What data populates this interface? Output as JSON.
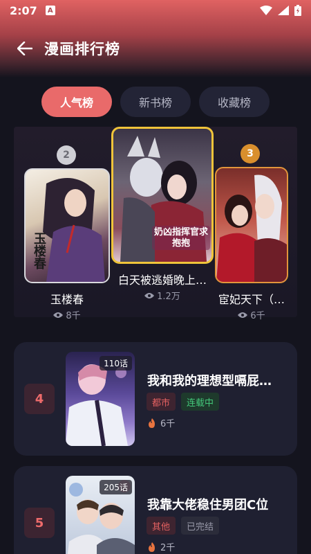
{
  "status": {
    "time": "2:07",
    "notif_letter": "A"
  },
  "app_bar": {
    "title": "漫画排行榜"
  },
  "tabs": [
    {
      "label": "人气榜",
      "active": true
    },
    {
      "label": "新书榜",
      "active": false
    },
    {
      "label": "收藏榜",
      "active": false
    }
  ],
  "podium": {
    "first": {
      "title": "白天被逃婚晚上…",
      "views": "1.2万",
      "cover_text": "奶凶指挥官求抱抱"
    },
    "second": {
      "rank": "2",
      "title": "玉楼春",
      "views": "8千",
      "cover_text": "玉楼春"
    },
    "third": {
      "rank": "3",
      "title": "宦妃天下（…",
      "views": "6千"
    }
  },
  "list": [
    {
      "rank": "4",
      "title": "我和我的理想型嗝屁…",
      "episodes": "110话",
      "tags": [
        "都市",
        "连载中"
      ],
      "hot": "6千"
    },
    {
      "rank": "5",
      "title": "我靠大佬稳住男团C位",
      "episodes": "205话",
      "tags": [
        "其他",
        "已完结"
      ],
      "hot": "2千"
    }
  ],
  "colors": {
    "accent": "#e96a6a",
    "bg": "#14141e",
    "card": "#1f2031",
    "gold": "#d98f2d",
    "silver": "#c9c9cf"
  },
  "icons": {
    "back": "arrow-left-icon",
    "views": "eye-icon",
    "hot": "flame-icon"
  }
}
